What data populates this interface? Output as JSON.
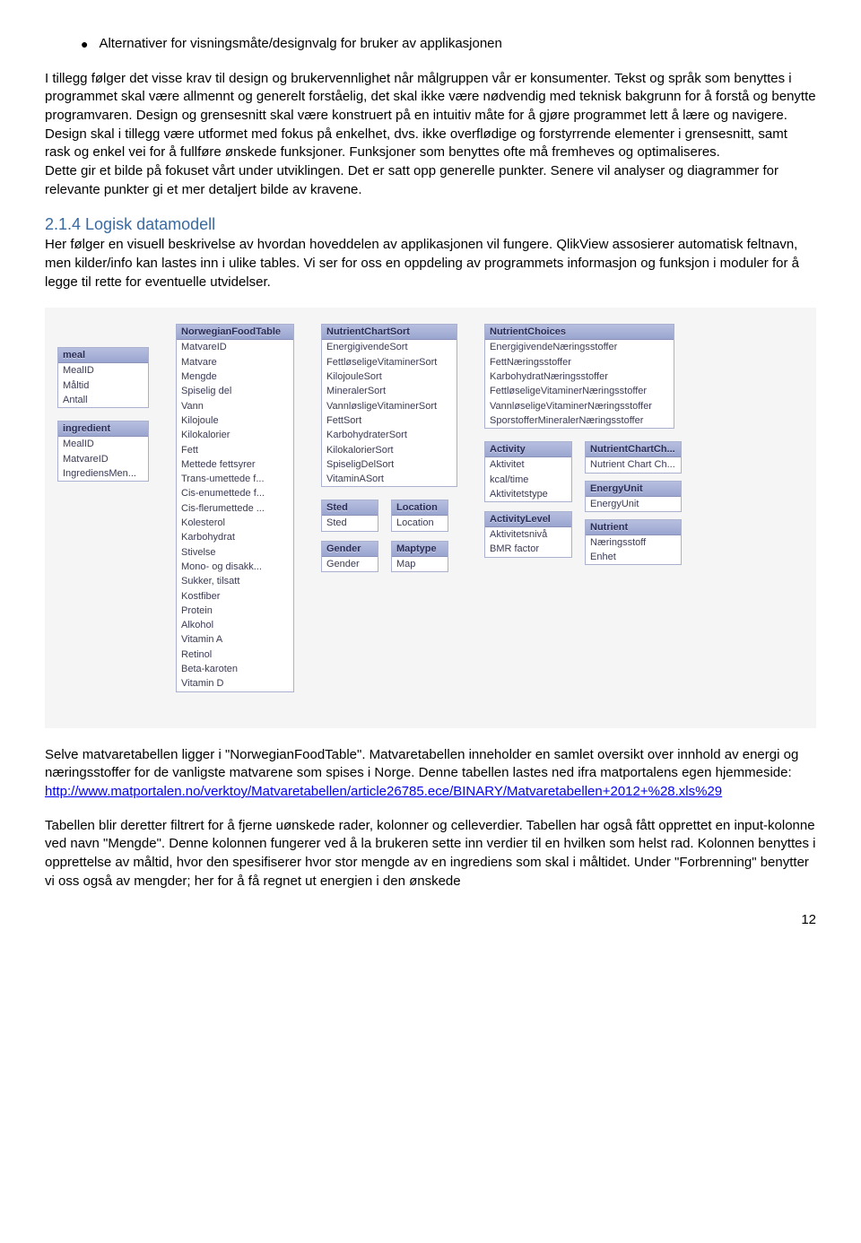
{
  "bullet": "Alternativer for visningsmåte/designvalg for bruker av applikasjonen",
  "para1": "I tillegg følger det visse krav til design og brukervennlighet når målgruppen vår er konsumenter. Tekst og språk som benyttes i programmet skal være allmennt og generelt forståelig, det skal ikke være nødvendig med teknisk bakgrunn for å forstå og benytte programvaren. Design og grensesnitt skal være konstruert på en intuitiv måte for å gjøre programmet lett å lære og navigere. Design skal i tillegg være utformet med fokus på enkelhet, dvs. ikke overflødige og forstyrrende elementer i grensesnitt, samt rask og enkel vei for å fullføre ønskede funksjoner. Funksjoner som benyttes ofte må fremheves og optimaliseres.",
  "para2": "Dette gir et bilde på fokuset vårt under utviklingen. Det er satt opp generelle punkter. Senere vil analyser og diagrammer for relevante punkter gi et mer detaljert bilde av kravene.",
  "heading": "2.1.4 Logisk datamodell",
  "para3": "Her følger en visuell beskrivelse av hvordan hoveddelen av applikasjonen vil fungere. QlikView assosierer automatisk feltnavn, men kilder/info kan lastes inn i ulike tables. Vi ser for oss en oppdeling av programmets informasjon og funksjon i moduler for å legge til rette for eventuelle utvidelser.",
  "para4a": "Selve matvaretabellen ligger i \"NorwegianFoodTable\". Matvaretabellen inneholder en samlet oversikt over innhold av energi og næringsstoffer for de vanligste matvarene som spises i Norge. Denne tabellen lastes ned ifra matportalens egen hjemmeside:",
  "link": "http://www.matportalen.no/verktoy/Matvaretabellen/article26785.ece/BINARY/Matvaretabellen+2012+%28.xls%29",
  "para5": "Tabellen blir deretter filtrert for å fjerne uønskede rader, kolonner og celleverdier. Tabellen har også fått opprettet en input-kolonne ved navn \"Mengde\". Denne kolonnen fungerer ved å la brukeren sette inn verdier til en hvilken som helst rad. Kolonnen benyttes i opprettelse av måltid, hvor den spesifiserer hvor stor mengde av en ingrediens som skal i måltidet. Under \"Forbrenning\" benytter vi oss også av mengder; her for å få regnet ut energien i den ønskede",
  "pagenum": "12",
  "tables": {
    "meal": {
      "title": "meal",
      "fields": [
        "MealID",
        "Måltid",
        "Antall"
      ]
    },
    "ingredient": {
      "title": "ingredient",
      "fields": [
        "MealID",
        "MatvareID",
        "IngrediensMen..."
      ]
    },
    "nft": {
      "title": "NorwegianFoodTable",
      "fields": [
        "MatvareID",
        "Matvare",
        "Mengde",
        "Spiselig del",
        "Vann",
        "Kilojoule",
        "Kilokalorier",
        "Fett",
        "Mettede fettsyrer",
        "Trans-umettede f...",
        "Cis-enumettede f...",
        "Cis-flerumettede ...",
        "Kolesterol",
        "Karbohydrat",
        "Stivelse",
        "Mono- og disakk...",
        "Sukker, tilsatt",
        "Kostfiber",
        "Protein",
        "Alkohol",
        "Vitamin A",
        "Retinol",
        "Beta-karoten",
        "Vitamin D"
      ]
    },
    "ncs": {
      "title": "NutrientChartSort",
      "fields": [
        "EnergigivendeSort",
        "FettløseligeVitaminerSort",
        "KilojouleSort",
        "MineralerSort",
        "VannløsligeVitaminerSort",
        "FettSort",
        "KarbohydraterSort",
        "KilokalorierSort",
        "SpiseligDelSort",
        "VitaminASort"
      ]
    },
    "sted": {
      "title": "Sted",
      "fields": [
        "Sted"
      ]
    },
    "gender": {
      "title": "Gender",
      "fields": [
        "Gender"
      ]
    },
    "location": {
      "title": "Location",
      "fields": [
        "Location"
      ]
    },
    "maptype": {
      "title": "Maptype",
      "fields": [
        "Map"
      ]
    },
    "nc": {
      "title": "NutrientChoices",
      "fields": [
        "EnergigivendeNæringsstoffer",
        "FettNæringsstoffer",
        "KarbohydratNæringsstoffer",
        "FettløseligeVitaminerNæringsstoffer",
        "VannløseligeVitaminerNæringsstoffer",
        "SporstofferMineralerNæringsstoffer"
      ]
    },
    "activity": {
      "title": "Activity",
      "fields": [
        "Aktivitet",
        "kcal/time",
        "Aktivitetstype"
      ]
    },
    "activitylevel": {
      "title": "ActivityLevel",
      "fields": [
        "Aktivitetsnivå",
        "BMR factor"
      ]
    },
    "ncc": {
      "title": "NutrientChartCh...",
      "fields": [
        "Nutrient Chart Ch..."
      ]
    },
    "energyunit": {
      "title": "EnergyUnit",
      "fields": [
        "EnergyUnit"
      ]
    },
    "nutrient": {
      "title": "Nutrient",
      "fields": [
        "Næringsstoff",
        "Enhet"
      ]
    }
  }
}
